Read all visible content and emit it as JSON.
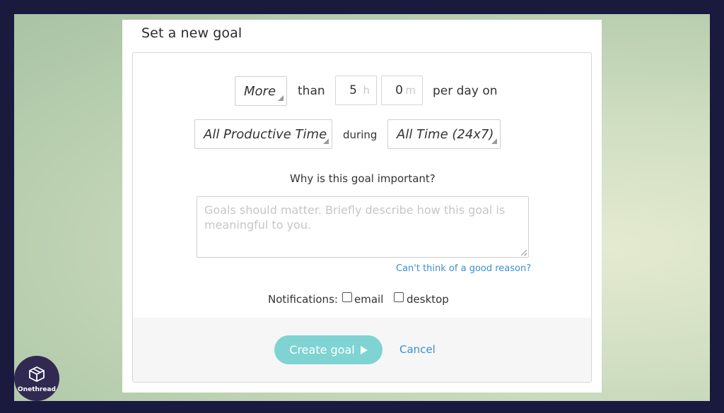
{
  "dialog": {
    "title": "Set a new goal"
  },
  "goal": {
    "comparison": "More",
    "than_label": "than",
    "hours_value": "5",
    "hours_unit": "h",
    "minutes_value": "0",
    "minutes_unit": "m",
    "per_day_label": "per day on",
    "category": "All Productive Time",
    "during_label": "during",
    "time_range": "All Time (24x7)"
  },
  "reason": {
    "label": "Why is this goal important?",
    "placeholder": "Goals should matter. Briefly describe how this goal is meaningful to you.",
    "help_link": "Can't think of a good reason?"
  },
  "notifications": {
    "label": "Notifications:",
    "email_label": "email",
    "email_checked": false,
    "desktop_label": "desktop",
    "desktop_checked": false
  },
  "actions": {
    "create_label": "Create goal",
    "cancel_label": "Cancel"
  },
  "brand": {
    "name": "Onethread",
    "logo_icon": "box-stack-icon"
  },
  "colors": {
    "frame": "#1a1a3e",
    "primary_button": "#7fd3d3",
    "link": "#3a8fd6",
    "logo_bg": "#302a52"
  }
}
